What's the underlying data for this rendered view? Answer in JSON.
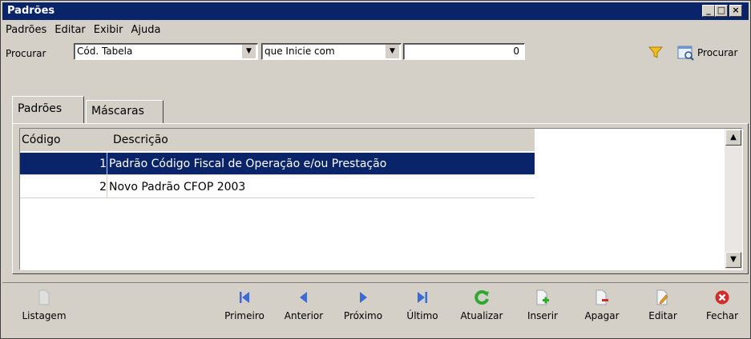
{
  "window": {
    "title": "Padrões",
    "controls": [
      "minimize-icon",
      "maximize-icon",
      "close-icon"
    ]
  },
  "menu": [
    "Padrões",
    "Editar",
    "Exibir",
    "Ajuda"
  ],
  "search": {
    "label": "Procurar",
    "field": "Cód. Tabela",
    "operator": "que Inicie com",
    "value": "0",
    "button": "Procurar"
  },
  "tabs": [
    "Padrões",
    "Máscaras"
  ],
  "grid": {
    "columns": [
      "Código",
      "Descrição"
    ],
    "rows": [
      {
        "code": "1",
        "desc": "Padrão Código Fiscal de Operação e/ou Prestação"
      },
      {
        "code": "2",
        "desc": "Novo Padrão CFOP 2003"
      }
    ]
  },
  "toolbar": {
    "listagem": "Listagem",
    "primeiro": "Primeiro",
    "anterior": "Anterior",
    "proximo": "Próximo",
    "ultimo": "Último",
    "atualizar": "Atualizar",
    "inserir": "Inserir",
    "apagar": "Apagar",
    "editar": "Editar",
    "fechar": "Fechar"
  },
  "colors": {
    "titlebar": "#0a246a",
    "selection": "#0a246a",
    "nav_icons": "#3a6bd6",
    "refresh": "#2fa82f",
    "close": "#d22b2b"
  }
}
